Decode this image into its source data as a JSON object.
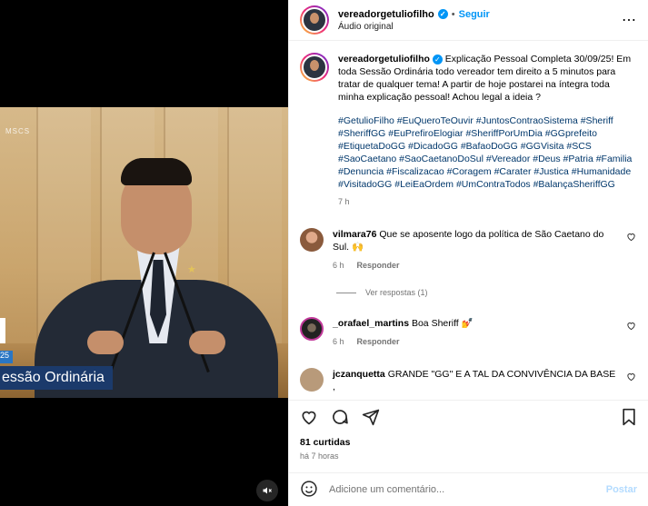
{
  "colors": {
    "accent": "#0095f6",
    "hashtag": "#00376b",
    "muted": "#737373"
  },
  "video": {
    "logo_text": "MSCS",
    "ticker_number": "25",
    "ticker_text": "essão Ordinária",
    "mute_icon": "muted-speaker-icon"
  },
  "header": {
    "username": "vereadorgetuliofilho",
    "separator": "•",
    "follow_label": "Seguir",
    "audio": "Áudio original",
    "more_icon": "more-options-icon"
  },
  "caption": {
    "username": "vereadorgetuliofilho",
    "text": "Explicação Pessoal Completa 30/09/25! Em toda Sessão Ordinária todo vereador tem direito a 5 minutos para tratar de qualquer tema! A partir de hoje postarei na íntegra toda minha explicação pessoal! Achou legal a ideia ?",
    "hashtags": "#GetulioFilho #EuQueroTeOuvir #JuntosContraoSistema #Sheriff #SheriffGG #EuPrefiroElogiar #SheriffPorUmDia #GGprefeito #EtiquetaDoGG #DicadoGG #BafaoDoGG #GGVisita #SCS #SaoCaetano #SaoCaetanoDoSul #Vereador #Deus #Patria #Familia #Denuncia #Fiscalizacao #Coragem #Carater #Justica #Humanidade #VisitadoGG #LeiEaOrdem #UmContraTodos #BalançaSheriffGG",
    "time": "7 h"
  },
  "comments": [
    {
      "username": "vilmara76",
      "text": "Que se aposente logo da política de São Caetano do Sul. 🙌",
      "time": "6 h",
      "reply": "Responder"
    },
    {
      "username": "_orafael_martins",
      "text": "Boa Sheriff 💅",
      "time": "6 h",
      "reply": "Responder"
    },
    {
      "username": "jczanquetta",
      "text": "GRANDE \"GG\" E A TAL DA CONVIVÊNCIA DA BASE ,"
    }
  ],
  "view_replies": "Ver respostas (1)",
  "likes": "81 curtidas",
  "time_ago": "há 7 horas",
  "add_comment": {
    "placeholder": "Adicione um comentário...",
    "post_label": "Postar"
  }
}
